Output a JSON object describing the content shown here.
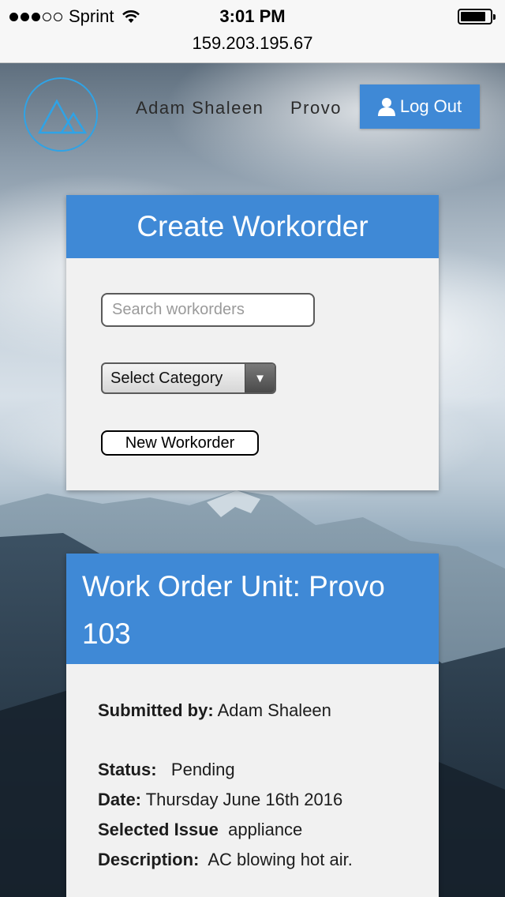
{
  "status_bar": {
    "carrier": "Sprint",
    "signal_bars_filled": 3,
    "signal_bars_total": 5,
    "time": "3:01 PM",
    "battery_level": 0.85,
    "url": "159.203.195.67"
  },
  "header": {
    "logo_icon": "mountain-logo-icon",
    "user_name": "Adam Shaleen",
    "location": "Provo",
    "logout_label": "Log Out",
    "logout_icon": "user-icon"
  },
  "create_workorder": {
    "title": "Create Workorder",
    "search_placeholder": "Search workorders",
    "search_value": "",
    "category_label": "Select Category",
    "new_button": "New Workorder"
  },
  "work_order": {
    "title": "Work Order Unit: Provo 103",
    "submitted_by_label": "Submitted by:",
    "submitted_by": "Adam Shaleen",
    "status_label": "Status:",
    "status": "Pending",
    "date_label": "Date:",
    "date": "Thursday June 16th 2016",
    "issue_label": "Selected Issue",
    "issue": "appliance",
    "description_label": "Description:",
    "description": "AC blowing hot air."
  },
  "colors": {
    "accent_blue": "#3f89d6",
    "logo_blue": "#2fa3e6",
    "card_bg": "#f1f1f1"
  }
}
